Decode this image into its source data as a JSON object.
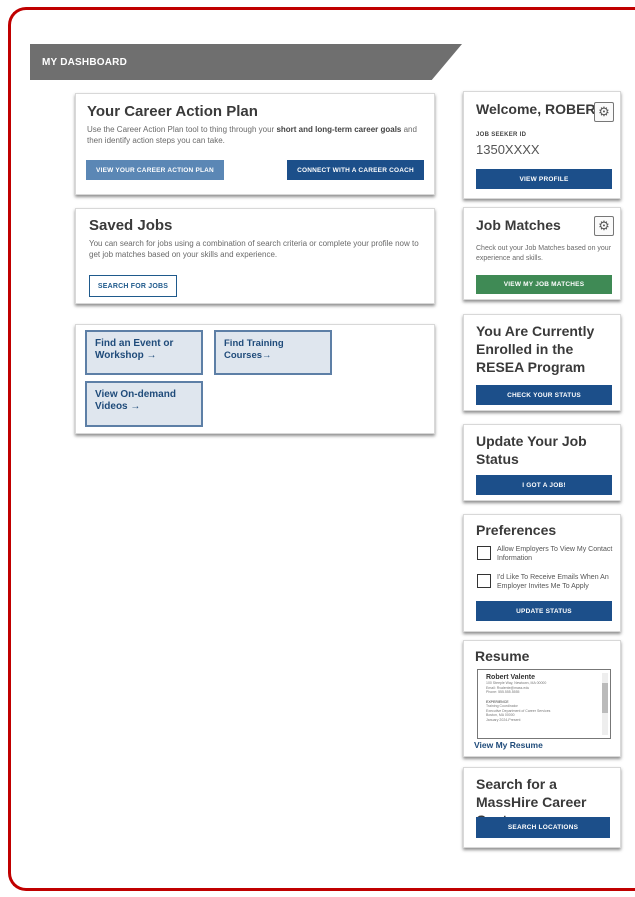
{
  "banner": {
    "title": "MY DASHBOARD"
  },
  "career_plan": {
    "title": "Your Career Action Plan",
    "text_a": "Use the Career Action Plan tool to thing through your ",
    "text_bold": "short and long-term career goals",
    "text_b": " and then identify action steps you can take.",
    "btn_view": "VIEW YOUR CAREER ACTION PLAN",
    "btn_coach": "CONNECT WITH A CAREER COACH"
  },
  "saved_jobs": {
    "title": "Saved Jobs",
    "text": "You can search for jobs using a combination of search criteria or complete your profile now to get job matches based on your skills and experience.",
    "btn": "SEARCH FOR JOBS"
  },
  "tiles": {
    "event": "Find an Event or Workshop",
    "training": "Find Training Courses",
    "videos": "View On-demand Videos",
    "arrow": "→"
  },
  "welcome": {
    "title": "Welcome, ROBERT",
    "id_label": "JOB SEEKER ID",
    "id_value": "1350XXXX",
    "btn": "VIEW PROFILE"
  },
  "job_matches": {
    "title": "Job Matches",
    "text": "Check out your Job Matches based on your experience and skills.",
    "btn": "VIEW MY JOB MATCHES"
  },
  "resea": {
    "title": "You Are Currently Enrolled in the RESEA Program",
    "btn": "CHECK YOUR STATUS"
  },
  "job_status": {
    "title": "Update Your Job Status",
    "btn": "I GOT A JOB!"
  },
  "preferences": {
    "title": "Preferences",
    "opt1": "Allow Employers To View My Contact Information",
    "opt2": "I'd Like To Receive Emails When An Employer Invites Me To Apply",
    "btn": "UPDATE STATUS"
  },
  "resume": {
    "title": "Resume",
    "name": "Robert Valente",
    "line1": "100 Steeple Way, Newtown, MA 00000",
    "line2": "Email: Rvalente@mass.edu",
    "line3": "Phone: 555.555.5555",
    "line4": "EXPERIENCE",
    "line5": "Training Coordinator",
    "line6": "Executive Department of Career Services",
    "line7": "Boston, MA 00000",
    "line8": "January 2024-Present",
    "link": "View My Resume"
  },
  "masshire": {
    "title": "Search for a MassHire Career Center",
    "btn": "SEARCH LOCATIONS"
  }
}
